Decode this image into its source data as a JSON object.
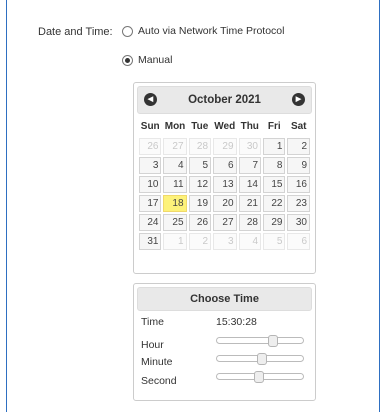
{
  "field_label": "Date and Time:",
  "options": [
    {
      "label": "Auto via Network Time Protocol",
      "checked": false
    },
    {
      "label": "Manual",
      "checked": true
    }
  ],
  "calendar": {
    "month_year": "October 2021",
    "prev_icon": "circle-triangle-left-icon",
    "next_icon": "circle-triangle-right-icon",
    "weekdays": [
      "Sun",
      "Mon",
      "Tue",
      "Wed",
      "Thu",
      "Fri",
      "Sat"
    ],
    "weeks": [
      [
        "26",
        "27",
        "28",
        "29",
        "30",
        "1",
        "2"
      ],
      [
        "3",
        "4",
        "5",
        "6",
        "7",
        "8",
        "9"
      ],
      [
        "10",
        "11",
        "12",
        "13",
        "14",
        "15",
        "16"
      ],
      [
        "17",
        "18",
        "19",
        "20",
        "21",
        "22",
        "23"
      ],
      [
        "24",
        "25",
        "26",
        "27",
        "28",
        "29",
        "30"
      ],
      [
        "31",
        "1",
        "2",
        "3",
        "4",
        "5",
        "6"
      ]
    ],
    "other_month": [
      [
        0,
        0
      ],
      [
        0,
        1
      ],
      [
        0,
        2
      ],
      [
        0,
        3
      ],
      [
        0,
        4
      ],
      [
        5,
        1
      ],
      [
        5,
        2
      ],
      [
        5,
        3
      ],
      [
        5,
        4
      ],
      [
        5,
        5
      ],
      [
        5,
        6
      ]
    ],
    "today": [
      3,
      1
    ],
    "today_color": "#fdf27a"
  },
  "time_picker": {
    "title": "Choose Time",
    "time_label": "Time",
    "time_value": "15:30:28",
    "hour_label": "Hour",
    "minute_label": "Minute",
    "second_label": "Second",
    "hour": 15,
    "minute": 30,
    "second": 28
  }
}
